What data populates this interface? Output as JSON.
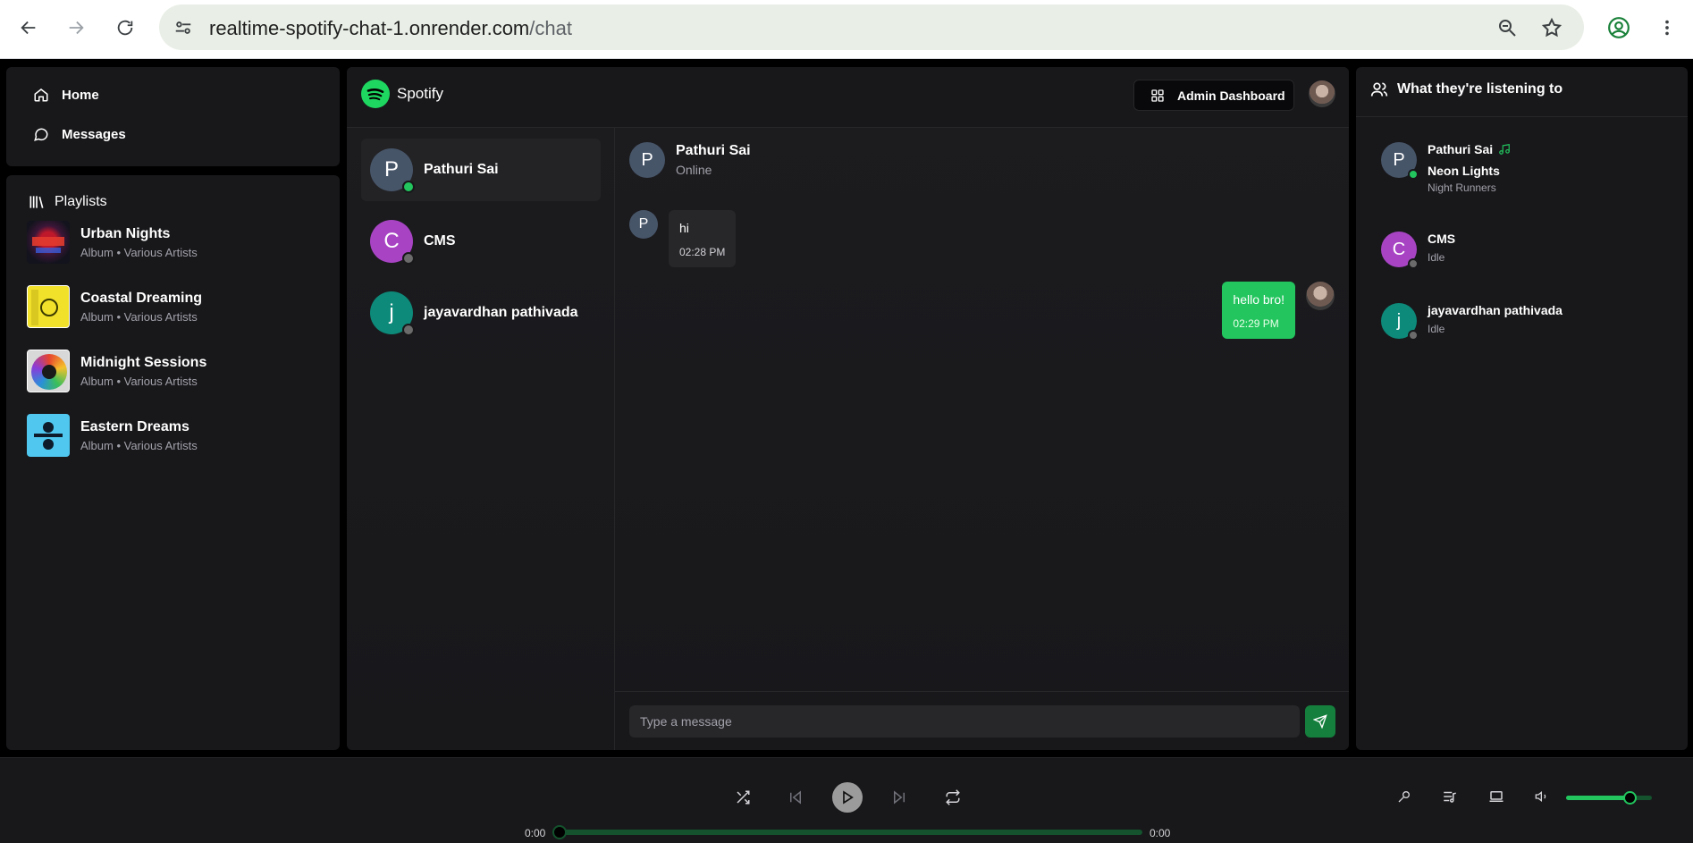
{
  "browser": {
    "url_host": "realtime-spotify-chat-1.onrender.com",
    "url_path": "/chat"
  },
  "nav": {
    "items": [
      {
        "label": "Home",
        "icon": "home-icon"
      },
      {
        "label": "Messages",
        "icon": "message-icon"
      }
    ]
  },
  "playlists": {
    "title": "Playlists",
    "items": [
      {
        "name": "Urban Nights",
        "subtitle": "Album • Various Artists"
      },
      {
        "name": "Coastal Dreaming",
        "subtitle": "Album • Various Artists"
      },
      {
        "name": "Midnight Sessions",
        "subtitle": "Album • Various Artists"
      },
      {
        "name": "Eastern Dreams",
        "subtitle": "Album • Various Artists"
      }
    ]
  },
  "header": {
    "brand": "Spotify",
    "admin_label": "Admin Dashboard"
  },
  "users": [
    {
      "initial": "P",
      "name": "Pathuri Sai",
      "online": true,
      "color": "#475569"
    },
    {
      "initial": "C",
      "name": "CMS",
      "online": false,
      "color": "#a844c4"
    },
    {
      "initial": "j",
      "name": "jayavardhan pathivada",
      "online": false,
      "color": "#0d8a7a"
    }
  ],
  "conversation": {
    "initial": "P",
    "name": "Pathuri Sai",
    "status": "Online",
    "messages": [
      {
        "from": "them",
        "text": "hi",
        "time": "02:28 PM"
      },
      {
        "from": "me",
        "text": "hello bro!",
        "time": "02:29 PM"
      }
    ],
    "input_placeholder": "Type a message"
  },
  "activity": {
    "title": "What they're listening to",
    "friends": [
      {
        "initial": "P",
        "name": "Pathuri Sai",
        "song": "Neon Lights",
        "artist": "Night Runners",
        "online": true
      },
      {
        "initial": "C",
        "name": "CMS",
        "status": "Idle",
        "online": false
      },
      {
        "initial": "j",
        "name": "jayavardhan pathivada",
        "status": "Idle",
        "online": false
      }
    ]
  },
  "player": {
    "current_time": "0:00",
    "duration": "0:00",
    "progress": 0,
    "volume": 0.75
  },
  "colors": {
    "accent": "#22c55e",
    "online": "#22c55e",
    "offline": "#6b6b6b"
  }
}
